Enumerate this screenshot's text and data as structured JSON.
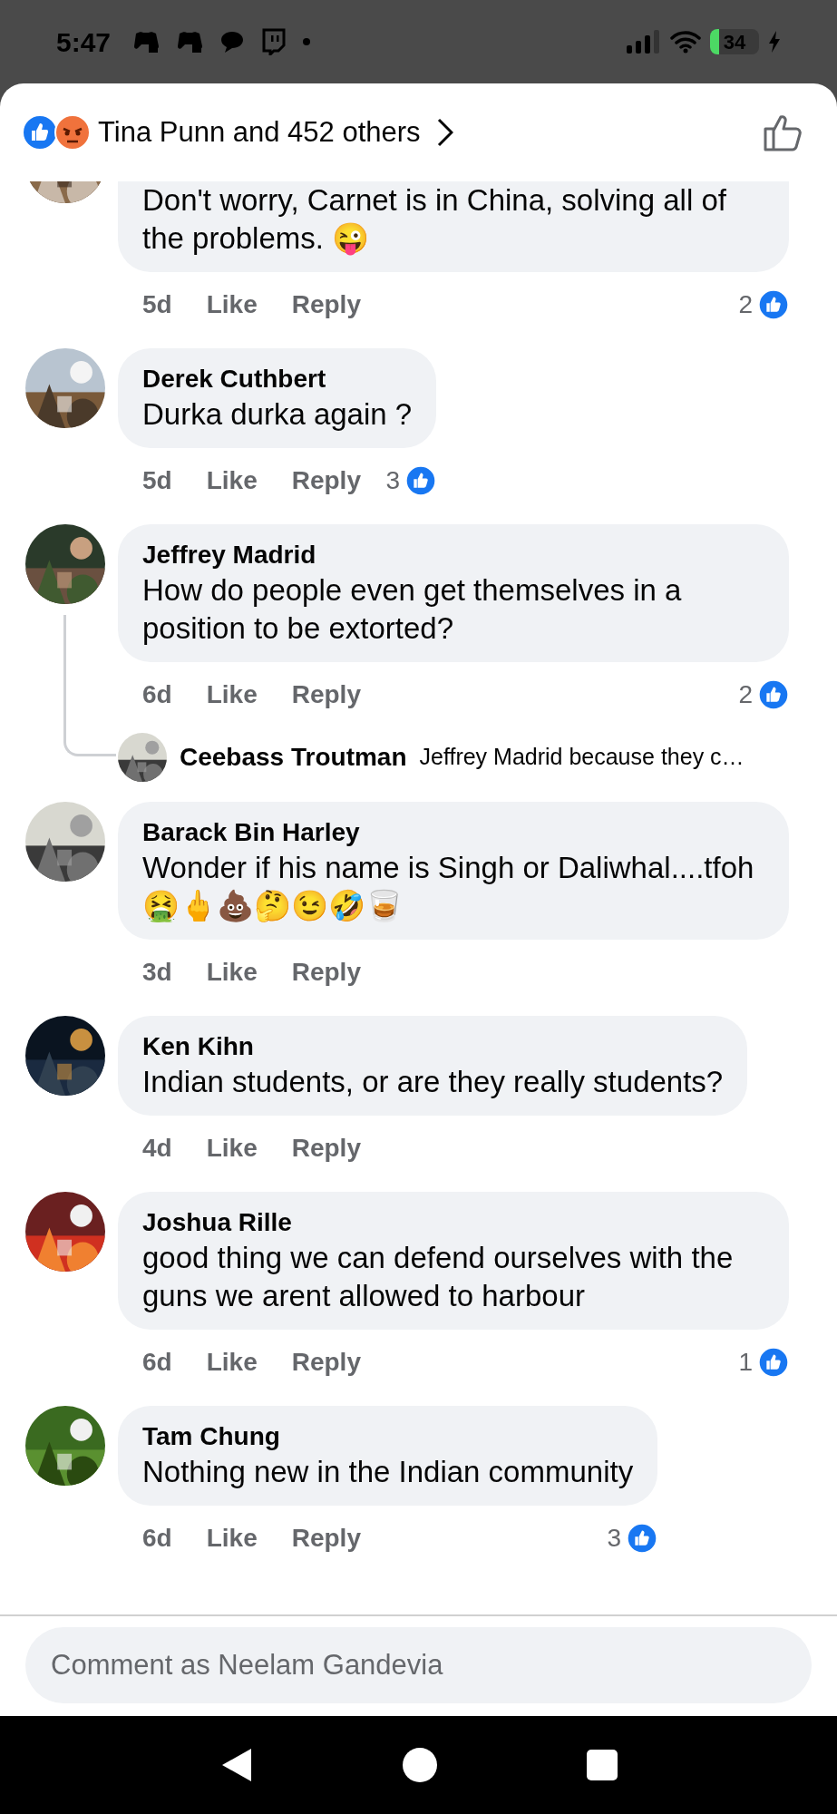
{
  "status_bar": {
    "time": "5:47",
    "battery": "34"
  },
  "header": {
    "title": "Tina Punn and 452 others"
  },
  "comments": [
    {
      "kind": "partial",
      "text": "Don't worry, Carnet is in China, solving all of the problems. 😜",
      "time": "5d",
      "like": "Like",
      "reply": "Reply",
      "reactions": "2"
    },
    {
      "kind": "full",
      "name": "Derek Cuthbert",
      "text": "Durka durka again ?",
      "time": "5d",
      "like": "Like",
      "reply": "Reply",
      "reactions": "3"
    },
    {
      "kind": "full",
      "name": "Jeffrey Madrid",
      "text": "How do people even get themselves in a position to be extorted?",
      "time": "6d",
      "like": "Like",
      "reply": "Reply",
      "reactions": "2",
      "replies": [
        {
          "name": "Ceebass Troutman",
          "text": "Jeffrey Madrid because they c…"
        }
      ]
    },
    {
      "kind": "full",
      "name": "Barack Bin Harley",
      "text": "Wonder if his name is Singh or Daliwhal....tfoh 🤮🖕💩🤔😉🤣🥃",
      "time": "3d",
      "like": "Like",
      "reply": "Reply"
    },
    {
      "kind": "full",
      "name": "Ken Kihn",
      "text": "Indian students, or are they really students?",
      "time": "4d",
      "like": "Like",
      "reply": "Reply"
    },
    {
      "kind": "full",
      "name": "Joshua Rille",
      "text": "good thing we can defend ourselves with the guns we arent allowed to harbour",
      "time": "6d",
      "like": "Like",
      "reply": "Reply",
      "reactions": "1"
    },
    {
      "kind": "full",
      "name": "Tam Chung",
      "text": "Nothing new in the Indian community",
      "time": "6d",
      "like": "Like",
      "reply": "Reply",
      "reactions": "3"
    }
  ],
  "comment_field": {
    "placeholder": "Comment as Neelam Gandevia"
  }
}
